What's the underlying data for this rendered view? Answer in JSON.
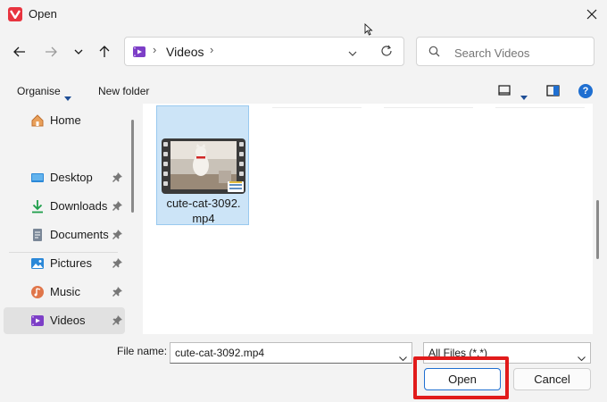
{
  "window": {
    "title": "Open",
    "app_icon": "vivaldi-icon",
    "accent": "#e8343f"
  },
  "nav": {
    "back_icon": "arrow-left-icon",
    "forward_icon": "arrow-right-icon",
    "recent_icon": "chevron-down-icon",
    "up_icon": "arrow-up-icon"
  },
  "address": {
    "location_icon": "videos-folder-icon",
    "segment": "Videos",
    "separator": "›"
  },
  "search": {
    "placeholder": "Search Videos"
  },
  "toolbar": {
    "organise_label": "Organise",
    "new_folder_label": "New folder",
    "help_label": "?"
  },
  "sidebar": {
    "items": [
      {
        "label": "Home",
        "icon": "home-icon",
        "pinned": false,
        "active": false
      },
      {
        "label": "Desktop",
        "icon": "desktop-icon",
        "pinned": true,
        "active": false
      },
      {
        "label": "Downloads",
        "icon": "download-icon",
        "pinned": true,
        "active": false
      },
      {
        "label": "Documents",
        "icon": "document-icon",
        "pinned": true,
        "active": false
      },
      {
        "label": "Pictures",
        "icon": "pictures-icon",
        "pinned": true,
        "active": false
      },
      {
        "label": "Music",
        "icon": "music-icon",
        "pinned": true,
        "active": false
      },
      {
        "label": "Videos",
        "icon": "videos-icon",
        "pinned": true,
        "active": true
      }
    ]
  },
  "files": [
    {
      "name": "cute-cat-3092.mp4",
      "name_line1": "cute-cat-3092.",
      "name_line2": "mp4",
      "selected": true,
      "thumbnail": "video-thumbnail-cat"
    }
  ],
  "bottom": {
    "file_name_label": "File name:",
    "file_name_value": "cute-cat-3092.mp4",
    "filter_value": "All Files (*.*)",
    "open_label": "Open",
    "cancel_label": "Cancel",
    "highlight_color": "#e11b1b"
  }
}
